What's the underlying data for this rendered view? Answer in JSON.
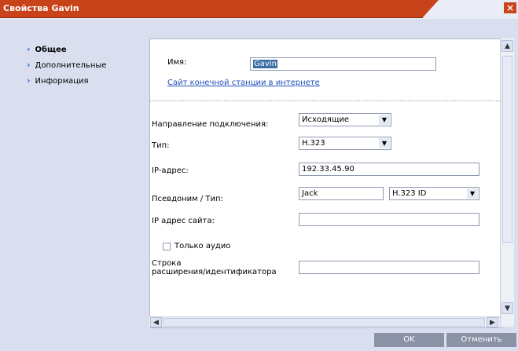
{
  "window": {
    "title": "Свойства Gavin",
    "close_label": "×"
  },
  "sidebar": {
    "items": [
      {
        "label": "Общее",
        "active": true
      },
      {
        "label": "Дополнительные",
        "active": false
      },
      {
        "label": "Информация",
        "active": false
      }
    ]
  },
  "form": {
    "name_label": "Имя:",
    "name_value": "Gavin",
    "site_link": "Сайт конечной станции в интернете",
    "direction_label": "Направление подключения:",
    "direction_value": "Исходящие",
    "type_label": "Тип:",
    "type_value": "H.323",
    "ip_label": "IP-адрес:",
    "ip_value": "192.33.45.90",
    "alias_label": "Псевдоним / Тип:",
    "alias_value": "Jack",
    "alias_type_value": "H.323 ID",
    "site_ip_label": "IP адрес сайта:",
    "site_ip_value": "",
    "audio_only_label": "Только аудио",
    "audio_only_checked": false,
    "extension_label_line1": "Строка",
    "extension_label_line2": "расширения/идентификатора",
    "extension_value": ""
  },
  "buttons": {
    "ok": "OK",
    "cancel": "Отменить"
  },
  "colors": {
    "title_bar": "#c8421a",
    "background": "#d9dfee",
    "link": "#1d4fbe",
    "button": "#8a93a6"
  }
}
